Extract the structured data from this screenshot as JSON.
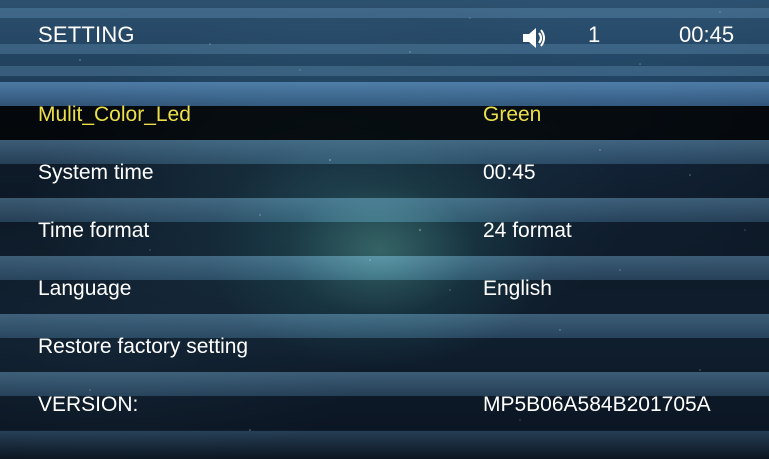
{
  "header": {
    "title": "SETTING",
    "volume_icon": "speaker-icon",
    "volume_level": "1",
    "clock": "00:45"
  },
  "settings": [
    {
      "label": "Mulit_Color_Led",
      "value": "Green",
      "selected": true
    },
    {
      "label": "System time",
      "value": "00:45",
      "selected": false
    },
    {
      "label": "Time format",
      "value": "24 format",
      "selected": false
    },
    {
      "label": "Language",
      "value": "English",
      "selected": false
    },
    {
      "label": "Restore factory setting",
      "value": "",
      "selected": false
    },
    {
      "label": "VERSION:",
      "value": "MP5B06A584B201705A",
      "selected": false
    }
  ],
  "colors": {
    "selected_text": "#ecdf4a",
    "text": "#ffffff"
  }
}
